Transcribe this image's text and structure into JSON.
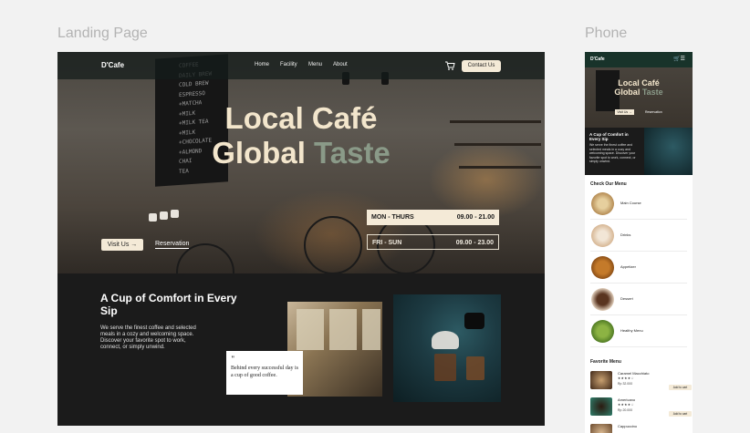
{
  "labels": {
    "landing": "Landing Page",
    "phone": "Phone"
  },
  "brand": "D'Cafe",
  "nav": {
    "home": "Home",
    "facility": "Facility",
    "menu": "Menu",
    "about": "About",
    "contact": "Contact Us"
  },
  "hero": {
    "line1": "Local Café",
    "line2a": "Global ",
    "line2b": "Taste",
    "visit": "Visit Us →",
    "reservation": "Reservation"
  },
  "hours": [
    {
      "days": "MON - THURS",
      "time": "09.00 - 21.00"
    },
    {
      "days": "FRI - SUN",
      "time": "09.00 - 23.00"
    }
  ],
  "chalkboard": [
    "COFFEE",
    "DAILY BREW",
    "COLD BREW",
    "ESPRESSO",
    "+MATCHA",
    "+MILK",
    "+MILK TEA",
    "+MILK",
    "+CHOCOLATE",
    "+ALMOND",
    "CHAI",
    "TEA"
  ],
  "about": {
    "title": "A Cup of Comfort in Every Sip",
    "text": "We serve the finest coffee and selected meals in a cozy and welcoming space. Discover your favorite spot to work, connect, or simply unwind."
  },
  "quote": {
    "mark": "\"",
    "text": "Behind every successful day is a cup of good coffee."
  },
  "phone": {
    "about_title": "A Cup of Comfort in Every Sip",
    "about_text": "We serve the finest coffee and selected meals in a cozy and welcoming space. Discover your favorite spot to work, connect, or simply unwind.",
    "visit": "Visit Us →",
    "reservation": "Reservation",
    "menu_title": "Check Our Menu",
    "menu_items": [
      "Main Course",
      "Drinks",
      "Appetizer",
      "Dessert",
      "Healthy Menu"
    ],
    "fav_title": "Favorite Menu",
    "favorites": [
      {
        "name": "Caramel Macchiato",
        "stars": "★★★★☆",
        "price": "Rp 32.000",
        "button": "Add to cart"
      },
      {
        "name": "Americano",
        "stars": "★★★★☆",
        "price": "Rp 20.000",
        "button": "Add to cart"
      },
      {
        "name": "Cappuccino",
        "stars": "★★★★☆",
        "price": "",
        "button": ""
      }
    ]
  },
  "colors": {
    "cream": "#f4ead7",
    "dark": "#1b1b1b",
    "nav_green": "#18332a",
    "accent_muted": "#8a9a88"
  }
}
